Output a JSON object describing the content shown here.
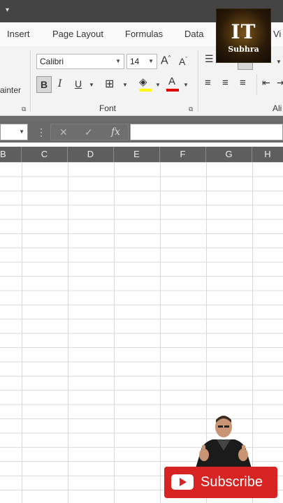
{
  "quick_access": {
    "icon": "customize-qat-arrow"
  },
  "ribbon_tabs": [
    "Insert",
    "Page Layout",
    "Formulas",
    "Data",
    "Vi"
  ],
  "clipboard": {
    "format_painter_partial": "ainter"
  },
  "font_group": {
    "font_name": "Calibri",
    "font_size": "14",
    "label": "Font",
    "bold": "B",
    "italic": "I",
    "underline": "U",
    "grow_font": "A",
    "shrink_font": "A",
    "font_color": "A",
    "fill_color_hex": "#ffff00",
    "font_color_hex": "#e00000"
  },
  "alignment_group": {
    "label_partial": "Ali"
  },
  "formula_bar": {
    "fx_label": "fx",
    "cancel": "✕",
    "enter": "✓",
    "more": "⋮"
  },
  "columns": [
    "B",
    "C",
    "D",
    "E",
    "F",
    "G",
    "H"
  ],
  "logo": {
    "line1": "IT",
    "line2": "Subhra"
  },
  "subscribe": {
    "label": "Subscribe"
  },
  "colors": {
    "accent": "#217346",
    "subscribe_red": "#d82323"
  }
}
